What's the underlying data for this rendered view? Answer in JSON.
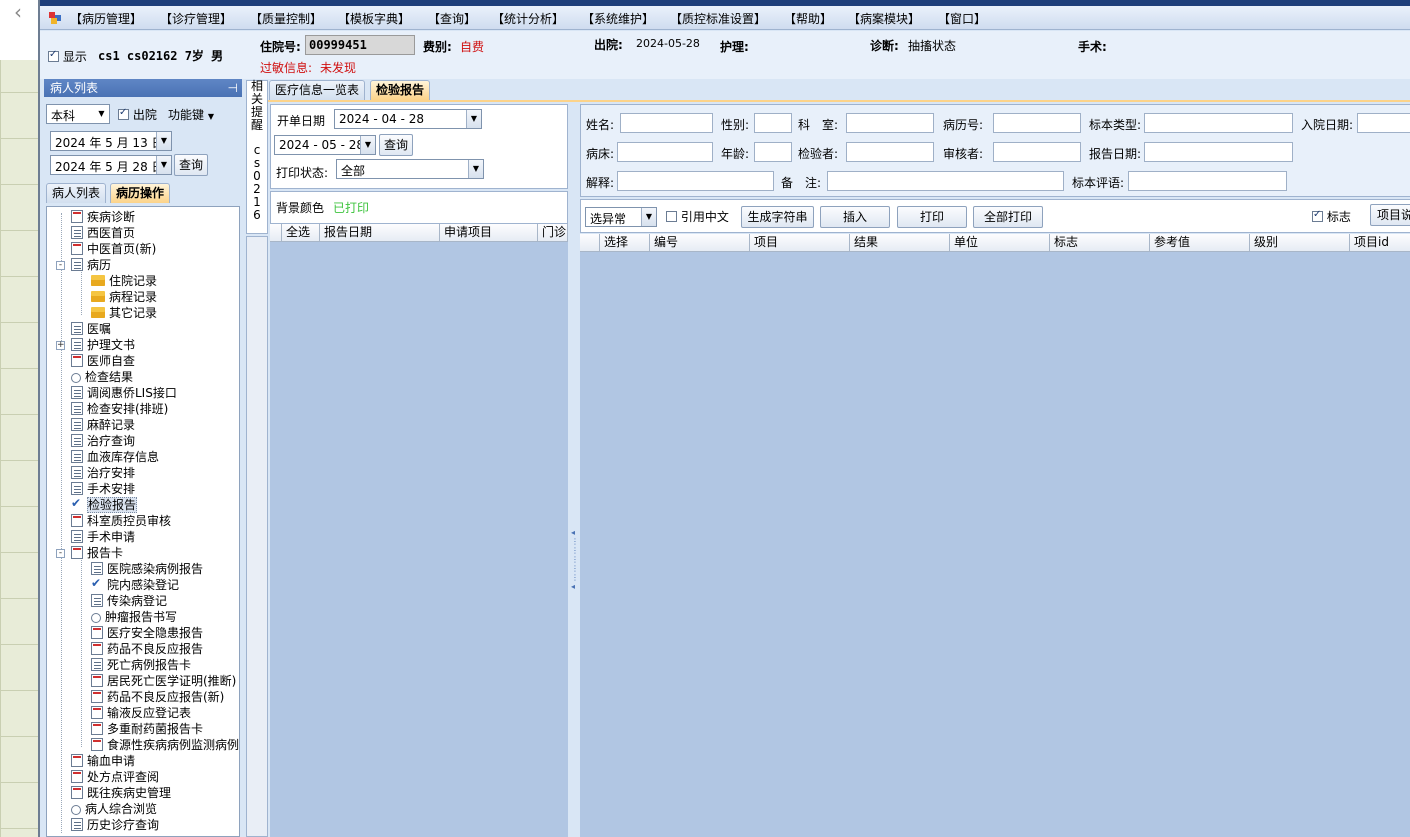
{
  "menu": [
    "【病历管理】",
    "【诊疗管理】",
    "【质量控制】",
    "【模板字典】",
    "【查询】",
    "【统计分析】",
    "【系统维护】",
    "【质控标准设置】",
    "【帮助】",
    "【病案模块】",
    "【窗口】"
  ],
  "patient": {
    "show_label": "显示",
    "summary": "cs1 cs02162 7岁 男",
    "admission_no_label": "住院号:",
    "admission_no": "00999451",
    "fee_type_label": "费别:",
    "fee_type": "自费",
    "discharge_label": "出院:",
    "discharge_date": "2024-05-28",
    "nursing_label": "护理:",
    "diagnosis_label": "诊断:",
    "diagnosis": "抽搐状态",
    "surgery_label": "手术:",
    "allergy_label": "过敏信息:",
    "allergy": "未发现"
  },
  "left_panel": {
    "title": "病人列表",
    "pin_icon": "pin-icon",
    "dept": "本科",
    "discharged_label": "出院",
    "function_key": "功能键",
    "date_from": "2024 年 5 月 13 日",
    "date_to": "2024 年 5 月 28 日",
    "query_button": "查询",
    "tabs": [
      "病人列表",
      "病历操作"
    ],
    "tree": [
      "疾病诊断",
      "西医首页",
      "中医首页(新)",
      "病历",
      "住院记录",
      "病程记录",
      "其它记录",
      "医嘱",
      "护理文书",
      "医师自查",
      "检查结果",
      "调阅惠侨LIS接口",
      "检查安排(排班)",
      "麻醉记录",
      "治疗查询",
      "血液库存信息",
      "治疗安排",
      "手术安排",
      "检验报告",
      "科室质控员审核",
      "手术申请",
      "报告卡",
      "医院感染病例报告",
      "院内感染登记",
      "传染病登记",
      "肿瘤报告书写",
      "医疗安全隐患报告",
      "药品不良反应报告",
      "死亡病例报告卡",
      "居民死亡医学证明(推断)",
      "药品不良反应报告(新)",
      "输液反应登记表",
      "多重耐药菌报告卡",
      "食源性疾病病例监测病例",
      "输血申请",
      "处方点评查阅",
      "既往疾病史管理",
      "病人综合浏览",
      "历史诊疗查询"
    ]
  },
  "side_vertical_tab": [
    "相",
    "关",
    "提",
    "醒",
    "c",
    "s",
    "0",
    "2",
    "1",
    "6"
  ],
  "content_tabs": [
    "医疗信息一览表",
    "检验报告"
  ],
  "filter": {
    "start_date_label": "开单日期",
    "start_date": "2024 - 04 - 28",
    "end_date": "2024 - 05 - 28",
    "query_button": "查询",
    "print_status_label": "打印状态:",
    "print_status": "全部",
    "bg_color_label": "背景颜色",
    "printed_label": "已打印"
  },
  "report_list_columns": [
    "全选",
    "报告日期",
    "申请项目",
    "门诊"
  ],
  "detail_fields": {
    "row1": [
      "姓名:",
      "性别:",
      "科　室:",
      "病历号:",
      "标本类型:",
      "入院日期:"
    ],
    "row2": [
      "病床:",
      "年龄:",
      "检验者:",
      "审核者:",
      "报告日期:"
    ],
    "row3": [
      "解释:",
      "备　注:",
      "标本评语:"
    ]
  },
  "toolbar": {
    "filter_select": "选异常",
    "cite_chinese_label": "引用中文",
    "gen_string_button": "生成字符串",
    "insert_button": "插入",
    "print_button": "打印",
    "print_all_button": "全部打印",
    "flag_label": "标志",
    "item_desc_button": "项目说"
  },
  "result_columns": [
    "选择",
    "编号",
    "项目",
    "结果",
    "单位",
    "标志",
    "参考值",
    "级别",
    "项目id"
  ],
  "colors": {
    "accent": "#4a72b4",
    "grid_bg": "#b1c6e3",
    "tab_active": "#fcd38a",
    "alert": "#d01010",
    "printed": "#3ec43e"
  }
}
